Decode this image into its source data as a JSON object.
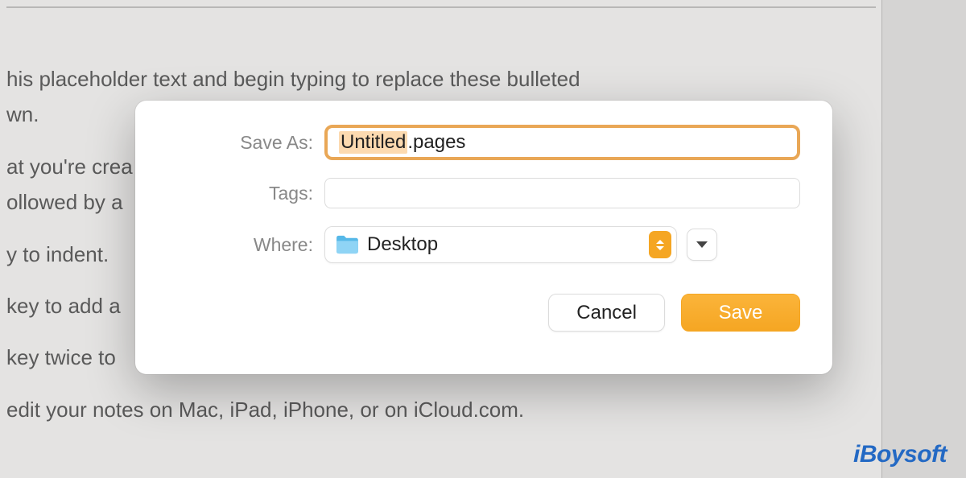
{
  "document": {
    "lines": [
      "his placeholder text and begin typing to replace these bulleted",
      "wn.",
      "at you're crea",
      "ollowed by a",
      "y to indent.",
      "key to add a",
      "key twice to",
      " edit your notes on Mac, iPad, iPhone, or on iCloud.com."
    ]
  },
  "dialog": {
    "saveAs": {
      "label": "Save As:",
      "highlighted": "Untitled",
      "suffix": ".pages"
    },
    "tags": {
      "label": "Tags:",
      "value": ""
    },
    "where": {
      "label": "Where:",
      "value": "Desktop"
    },
    "buttons": {
      "cancel": "Cancel",
      "save": "Save"
    }
  },
  "watermark": "iBoysoft"
}
